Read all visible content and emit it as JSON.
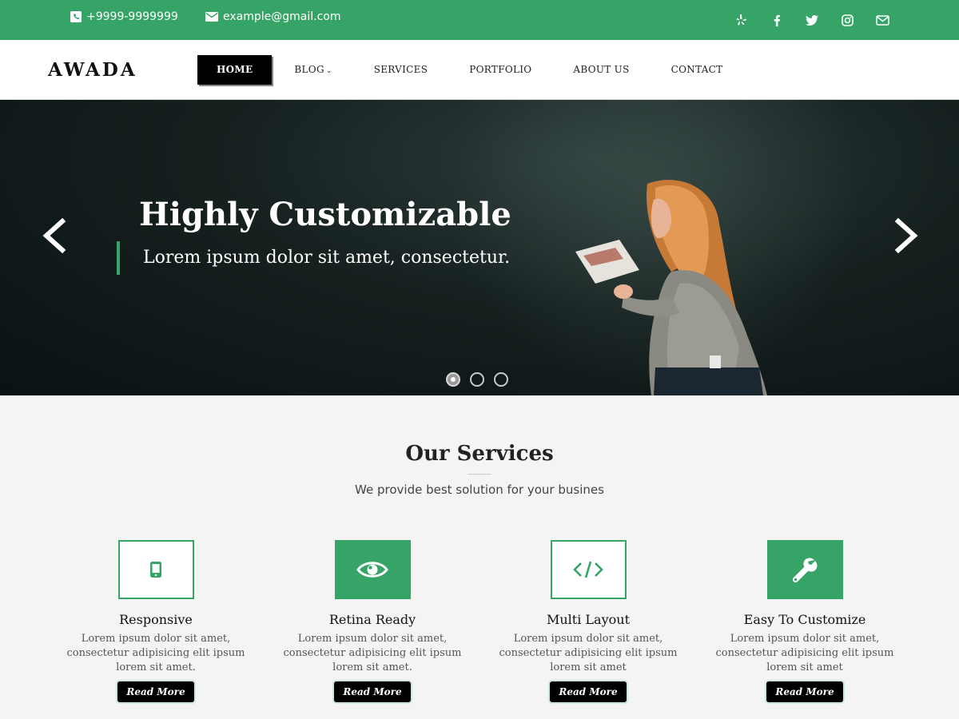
{
  "topbar": {
    "phone": "+9999-9999999",
    "email": "example@gmail.com",
    "socials": [
      "yelp-icon",
      "facebook-icon",
      "twitter-icon",
      "instagram-icon",
      "envelope-icon"
    ]
  },
  "header": {
    "logo": "AWADA",
    "nav": [
      {
        "label": "HOME",
        "active": true
      },
      {
        "label": "BLOG",
        "has_dropdown": true
      },
      {
        "label": "SERVICES"
      },
      {
        "label": "PORTFOLIO"
      },
      {
        "label": "ABOUT US"
      },
      {
        "label": "CONTACT"
      }
    ]
  },
  "hero": {
    "title": "Highly Customizable",
    "subtitle": "Lorem ipsum dolor sit amet, consectetur.",
    "slides_count": 3,
    "active_slide": 1
  },
  "services": {
    "title": "Our Services",
    "subtitle": "We provide best solution for your busines",
    "items": [
      {
        "title": "Responsive",
        "text": "Lorem ipsum dolor sit amet, consectetur adipisicing elit ipsum lorem sit amet.",
        "button": "Read More",
        "icon": "mobile-icon"
      },
      {
        "title": "Retina Ready",
        "text": "Lorem ipsum dolor sit amet, consectetur adipisicing elit ipsum lorem sit amet.",
        "button": "Read More",
        "icon": "eye-icon"
      },
      {
        "title": "Multi Layout",
        "text": "Lorem ipsum dolor sit amet, consectetur adipisicing elit ipsum lorem sit amet",
        "button": "Read More",
        "icon": "code-icon"
      },
      {
        "title": "Easy To Customize",
        "text": "Lorem ipsum dolor sit amet, consectetur adipisicing elit ipsum lorem sit amet",
        "button": "Read More",
        "icon": "wrench-icon"
      }
    ]
  },
  "colors": {
    "accent": "#35a466",
    "nav_active_bg": "#000000",
    "hero_bg": "#15201f"
  }
}
